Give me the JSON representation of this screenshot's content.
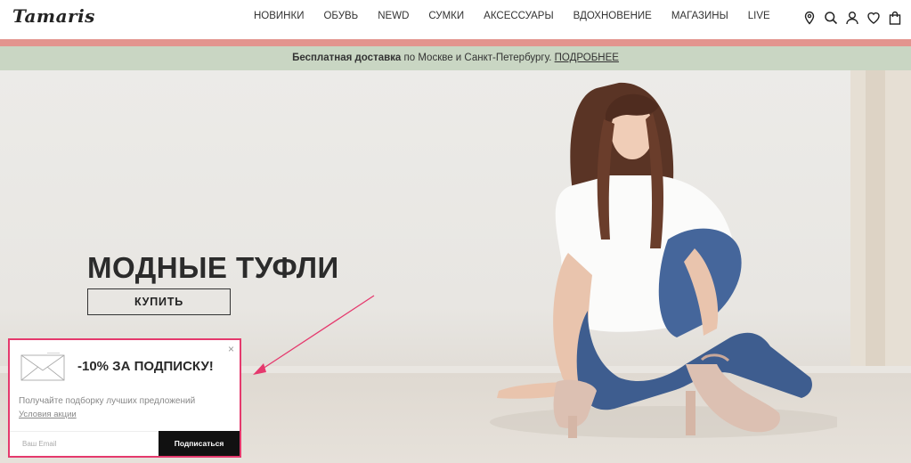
{
  "header": {
    "logo": "Tamaris",
    "nav": [
      "НОВИНКИ",
      "ОБУВЬ",
      "NEWD",
      "СУМКИ",
      "АКСЕССУАРЫ",
      "ВДОХНОВЕНИЕ",
      "МАГАЗИНЫ",
      "LIVE"
    ],
    "icons": [
      "location-pin-icon",
      "search-icon",
      "user-icon",
      "heart-icon",
      "bag-icon"
    ]
  },
  "promo": {
    "bold": "Бесплатная доставка",
    "text": " по Москве и Санкт-Петербургу. ",
    "link": "ПОДРОБНЕЕ"
  },
  "hero": {
    "title": "МОДНЫЕ ТУФЛИ",
    "button": "КУПИТЬ"
  },
  "popup": {
    "close": "×",
    "title": "-10% ЗА ПОДПИСКУ!",
    "text": "Получайте подборку лучших предложений",
    "link": "Условия акции",
    "email_placeholder": "Ваш Email",
    "button": "Подписаться"
  },
  "colors": {
    "pink_bar": "#e3948e",
    "promo_bar": "#c9d6c3",
    "popup_border": "#e5396d",
    "arrow": "#e5396d"
  }
}
